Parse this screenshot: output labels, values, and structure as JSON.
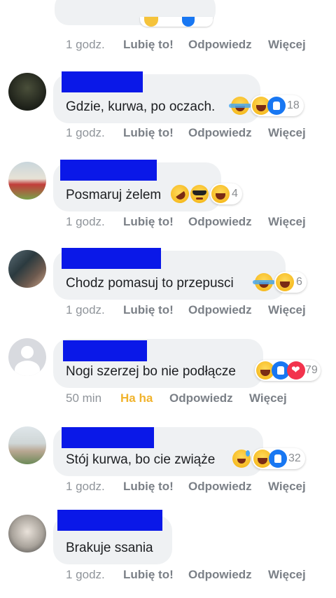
{
  "actions": {
    "like": "Lubię to!",
    "reply": "Odpowiedz",
    "more": "Więcej"
  },
  "top": {
    "time": "1 godz."
  },
  "comments": [
    {
      "text": "Gdzie, kurwa, po oczach.",
      "reaction_count": "18",
      "time": "1 godz.",
      "reaction_state": "Lubię to!"
    },
    {
      "text": "Posmaruj żelem",
      "reaction_count": "4",
      "time": "1 godz.",
      "reaction_state": "Lubię to!"
    },
    {
      "text": "Chodz pomasuj to przepusci",
      "reaction_count": "6",
      "time": "1 godz.",
      "reaction_state": "Lubię to!"
    },
    {
      "text": "Nogi szerzej bo nie podłącze",
      "reaction_count": "79",
      "time": "50 min",
      "reaction_state": "Ha ha"
    },
    {
      "text": "Stój kurwa, bo cie zwiąże",
      "reaction_count": "32",
      "time": "1 godz.",
      "reaction_state": "Lubię to!"
    },
    {
      "text": "Brakuje ssania",
      "time": "1 godz.",
      "reaction_state": "Lubię to!"
    }
  ]
}
